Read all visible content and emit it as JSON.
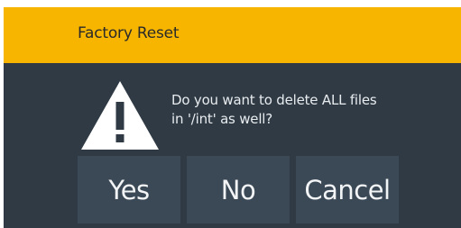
{
  "dialog": {
    "title": "Factory Reset",
    "message_line1": "Do you want to delete ALL files",
    "message_line2": "in '/int' as well?",
    "icon": "warning-icon",
    "buttons": {
      "yes": "Yes",
      "no": "No",
      "cancel": "Cancel"
    }
  },
  "colors": {
    "titlebar": "#f7b500",
    "dialog_bg": "#2f3a44",
    "button_bg": "#3b4956",
    "text": "#f2f4f6"
  }
}
